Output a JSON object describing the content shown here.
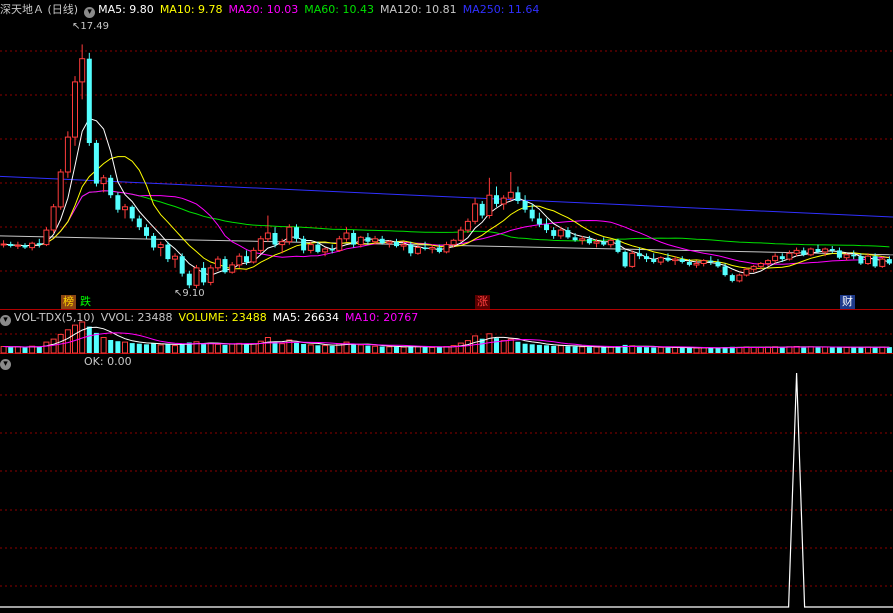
{
  "main": {
    "title": "深天地Ａ (日线)",
    "indicators": [
      {
        "text": "MA5: 9.80",
        "color": "#ffffff"
      },
      {
        "text": "MA10: 9.78",
        "color": "#ffff00"
      },
      {
        "text": "MA20: 10.03",
        "color": "#ff00ff"
      },
      {
        "text": "MA60: 10.43",
        "color": "#00e000"
      },
      {
        "text": "MA120: 10.81",
        "color": "#c8c8c8"
      },
      {
        "text": "MA250: 11.64",
        "color": "#3030ff"
      }
    ],
    "high_label": "17.49",
    "low_label": "9.10",
    "badges": [
      {
        "text": "榜",
        "color": "#ffd700",
        "bg": "#8b4513"
      },
      {
        "text": "跌",
        "color": "#00ff00",
        "bg": "#000000"
      },
      {
        "text": "涨",
        "color": "#ff4040",
        "bg": "#5a0000"
      },
      {
        "text": "财",
        "color": "#ffffff",
        "bg": "#1e3a8a"
      }
    ]
  },
  "volume": {
    "indicators": [
      {
        "text": "VOL-TDX(5,10)",
        "color": "#c8c8c8"
      },
      {
        "text": "VVOL: 23488",
        "color": "#c8c8c8"
      },
      {
        "text": "VOLUME: 23488",
        "color": "#ffff00"
      },
      {
        "text": "MA5: 26634",
        "color": "#ffffff"
      },
      {
        "text": "MA10: 20767",
        "color": "#ff00ff"
      }
    ]
  },
  "ok_panel": {
    "label": "OK: 0.00"
  },
  "colors": {
    "up": "#ff3c3c",
    "down": "#54ffff",
    "grid": "#8b0000",
    "ma5": "#ffffff",
    "ma10": "#ffff00",
    "ma20": "#ff00ff",
    "ma60": "#00e000",
    "ma120": "#c8c8c8",
    "ma250": "#3030ff"
  },
  "chart_data": {
    "type": "candlestick",
    "price_range": [
      8.9,
      18.4
    ],
    "candles": [
      [
        10.6,
        10.75,
        10.5,
        10.62
      ],
      [
        10.62,
        10.7,
        10.5,
        10.55
      ],
      [
        10.55,
        10.7,
        10.45,
        10.58
      ],
      [
        10.58,
        10.65,
        10.45,
        10.5
      ],
      [
        10.5,
        10.7,
        10.4,
        10.65
      ],
      [
        10.65,
        10.8,
        10.5,
        10.6
      ],
      [
        10.6,
        11.2,
        10.55,
        11.1
      ],
      [
        11.1,
        12.0,
        11.0,
        11.9
      ],
      [
        11.9,
        13.2,
        11.8,
        13.1
      ],
      [
        13.1,
        14.5,
        12.9,
        14.3
      ],
      [
        14.3,
        16.4,
        14.0,
        16.2
      ],
      [
        16.2,
        17.49,
        15.6,
        17.0
      ],
      [
        17.0,
        17.2,
        14.0,
        14.1
      ],
      [
        14.1,
        14.2,
        12.6,
        12.7
      ],
      [
        12.7,
        13.0,
        12.4,
        12.9
      ],
      [
        12.9,
        13.0,
        12.2,
        12.3
      ],
      [
        12.3,
        12.4,
        11.7,
        11.8
      ],
      [
        11.8,
        12.0,
        11.5,
        11.9
      ],
      [
        11.9,
        11.95,
        11.4,
        11.5
      ],
      [
        11.5,
        11.6,
        11.1,
        11.2
      ],
      [
        11.2,
        11.3,
        10.8,
        10.9
      ],
      [
        10.9,
        11.0,
        10.4,
        10.5
      ],
      [
        10.5,
        10.7,
        10.2,
        10.6
      ],
      [
        10.6,
        10.7,
        10.0,
        10.1
      ],
      [
        10.1,
        10.3,
        9.8,
        10.2
      ],
      [
        10.2,
        10.3,
        9.5,
        9.6
      ],
      [
        9.6,
        9.7,
        9.1,
        9.2
      ],
      [
        9.2,
        9.9,
        9.1,
        9.8
      ],
      [
        9.8,
        10.0,
        9.2,
        9.3
      ],
      [
        9.3,
        9.9,
        9.2,
        9.8
      ],
      [
        9.8,
        10.2,
        9.7,
        10.1
      ],
      [
        10.1,
        10.2,
        9.6,
        9.65
      ],
      [
        9.65,
        10.0,
        9.6,
        9.9
      ],
      [
        9.9,
        10.3,
        9.8,
        10.2
      ],
      [
        10.2,
        10.4,
        9.9,
        10.0
      ],
      [
        10.0,
        10.5,
        9.95,
        10.4
      ],
      [
        10.4,
        10.9,
        10.3,
        10.8
      ],
      [
        10.8,
        11.6,
        10.7,
        11.0
      ],
      [
        11.0,
        11.2,
        10.5,
        10.6
      ],
      [
        10.6,
        10.8,
        10.3,
        10.7
      ],
      [
        10.7,
        11.3,
        10.6,
        11.2
      ],
      [
        11.2,
        11.3,
        10.7,
        10.8
      ],
      [
        10.8,
        10.9,
        10.3,
        10.4
      ],
      [
        10.4,
        10.7,
        10.3,
        10.6
      ],
      [
        10.6,
        10.7,
        10.3,
        10.35
      ],
      [
        10.35,
        10.5,
        10.2,
        10.45
      ],
      [
        10.45,
        10.6,
        10.3,
        10.4
      ],
      [
        10.4,
        10.9,
        10.35,
        10.8
      ],
      [
        10.8,
        11.2,
        10.7,
        11.0
      ],
      [
        11.0,
        11.1,
        10.5,
        10.6
      ],
      [
        10.6,
        10.9,
        10.5,
        10.85
      ],
      [
        10.85,
        11.0,
        10.6,
        10.7
      ],
      [
        10.7,
        10.9,
        10.6,
        10.8
      ],
      [
        10.8,
        10.9,
        10.6,
        10.65
      ],
      [
        10.65,
        10.75,
        10.5,
        10.7
      ],
      [
        10.7,
        10.8,
        10.5,
        10.55
      ],
      [
        10.55,
        10.7,
        10.4,
        10.6
      ],
      [
        10.6,
        10.7,
        10.2,
        10.3
      ],
      [
        10.3,
        10.6,
        10.25,
        10.5
      ],
      [
        10.5,
        10.7,
        10.4,
        10.45
      ],
      [
        10.45,
        10.6,
        10.3,
        10.5
      ],
      [
        10.5,
        10.6,
        10.3,
        10.35
      ],
      [
        10.35,
        10.7,
        10.3,
        10.6
      ],
      [
        10.6,
        10.8,
        10.5,
        10.75
      ],
      [
        10.75,
        11.2,
        10.7,
        11.1
      ],
      [
        11.1,
        11.5,
        11.0,
        11.4
      ],
      [
        11.4,
        12.2,
        11.3,
        12.0
      ],
      [
        12.0,
        12.1,
        11.5,
        11.6
      ],
      [
        11.6,
        12.9,
        11.5,
        12.3
      ],
      [
        12.3,
        12.6,
        11.9,
        12.0
      ],
      [
        12.0,
        12.3,
        11.8,
        12.2
      ],
      [
        12.2,
        13.1,
        12.1,
        12.4
      ],
      [
        12.4,
        12.6,
        12.0,
        12.1
      ],
      [
        12.1,
        12.3,
        11.7,
        11.8
      ],
      [
        11.8,
        12.0,
        11.4,
        11.5
      ],
      [
        11.5,
        11.7,
        11.2,
        11.3
      ],
      [
        11.3,
        11.5,
        11.0,
        11.1
      ],
      [
        11.1,
        11.2,
        10.8,
        10.9
      ],
      [
        10.9,
        11.2,
        10.8,
        11.1
      ],
      [
        11.1,
        11.2,
        10.8,
        10.85
      ],
      [
        10.85,
        11.0,
        10.7,
        10.75
      ],
      [
        10.75,
        10.9,
        10.6,
        10.8
      ],
      [
        10.8,
        10.9,
        10.6,
        10.65
      ],
      [
        10.65,
        10.8,
        10.5,
        10.7
      ],
      [
        10.7,
        10.85,
        10.55,
        10.6
      ],
      [
        10.6,
        10.8,
        10.5,
        10.75
      ],
      [
        10.75,
        10.8,
        10.3,
        10.35
      ],
      [
        10.35,
        10.4,
        9.8,
        9.85
      ],
      [
        9.85,
        10.4,
        9.8,
        10.3
      ],
      [
        10.3,
        10.5,
        10.1,
        10.2
      ],
      [
        10.2,
        10.3,
        10.0,
        10.1
      ],
      [
        10.1,
        10.3,
        9.95,
        10.0
      ],
      [
        10.0,
        10.2,
        9.9,
        10.15
      ],
      [
        10.15,
        10.3,
        10.0,
        10.05
      ],
      [
        10.05,
        10.2,
        9.9,
        10.1
      ],
      [
        10.1,
        10.2,
        9.95,
        10.0
      ],
      [
        10.0,
        10.1,
        9.85,
        9.9
      ],
      [
        9.9,
        10.05,
        9.8,
        9.95
      ],
      [
        9.95,
        10.1,
        9.85,
        10.05
      ],
      [
        10.05,
        10.2,
        9.9,
        10.0
      ],
      [
        10.0,
        10.1,
        9.8,
        9.85
      ],
      [
        9.85,
        9.95,
        9.5,
        9.55
      ],
      [
        9.55,
        9.6,
        9.3,
        9.35
      ],
      [
        9.35,
        9.6,
        9.3,
        9.55
      ],
      [
        9.55,
        9.8,
        9.5,
        9.75
      ],
      [
        9.75,
        9.9,
        9.65,
        9.85
      ],
      [
        9.85,
        10.0,
        9.75,
        9.95
      ],
      [
        9.95,
        10.1,
        9.85,
        10.05
      ],
      [
        10.05,
        10.3,
        9.95,
        10.2
      ],
      [
        10.2,
        10.3,
        10.0,
        10.1
      ],
      [
        10.1,
        10.4,
        10.05,
        10.3
      ],
      [
        10.3,
        10.5,
        10.2,
        10.4
      ],
      [
        10.4,
        10.5,
        10.2,
        10.25
      ],
      [
        10.25,
        10.5,
        10.2,
        10.45
      ],
      [
        10.45,
        10.6,
        10.3,
        10.35
      ],
      [
        10.35,
        10.5,
        10.2,
        10.45
      ],
      [
        10.45,
        10.55,
        10.3,
        10.4
      ],
      [
        10.4,
        10.5,
        10.1,
        10.15
      ],
      [
        10.15,
        10.3,
        10.05,
        10.25
      ],
      [
        10.25,
        10.4,
        10.1,
        10.2
      ],
      [
        10.2,
        10.3,
        9.9,
        9.95
      ],
      [
        9.95,
        10.3,
        9.9,
        10.2
      ],
      [
        10.2,
        10.3,
        9.8,
        9.85
      ],
      [
        9.85,
        10.2,
        9.8,
        10.1
      ],
      [
        10.1,
        10.2,
        9.9,
        9.95
      ]
    ],
    "volume": [
      2.1,
      1.9,
      2.0,
      1.8,
      2.2,
      2.0,
      3.5,
      4.5,
      6.0,
      7.5,
      9.0,
      10.0,
      8.5,
      6.5,
      5.0,
      4.2,
      3.8,
      3.5,
      3.2,
      3.0,
      2.8,
      3.2,
      2.6,
      2.8,
      2.4,
      3.0,
      3.4,
      3.6,
      3.0,
      3.2,
      2.8,
      2.6,
      2.9,
      3.1,
      2.7,
      3.0,
      3.8,
      5.0,
      3.6,
      3.0,
      4.2,
      3.3,
      2.9,
      2.6,
      2.5,
      2.4,
      2.3,
      3.0,
      3.5,
      2.8,
      2.6,
      2.4,
      2.2,
      2.1,
      2.0,
      2.0,
      1.9,
      2.2,
      2.0,
      1.9,
      1.8,
      1.9,
      2.1,
      2.4,
      3.2,
      4.0,
      5.5,
      4.6,
      6.2,
      4.8,
      4.0,
      4.5,
      3.6,
      3.0,
      2.8,
      2.6,
      2.5,
      2.3,
      2.4,
      2.2,
      2.1,
      2.0,
      1.9,
      1.9,
      1.8,
      1.9,
      2.2,
      2.6,
      2.3,
      2.0,
      1.9,
      1.8,
      1.8,
      1.7,
      1.8,
      1.7,
      1.7,
      1.6,
      1.7,
      1.7,
      1.6,
      1.9,
      2.0,
      1.8,
      1.9,
      1.8,
      1.8,
      1.9,
      2.0,
      1.9,
      2.0,
      2.1,
      1.9,
      2.0,
      1.9,
      1.9,
      1.9,
      1.8,
      1.8,
      1.8,
      1.9,
      1.9,
      1.8,
      1.9,
      1.9
    ],
    "ma_lines": {
      "ma120": [
        10.9,
        10.25
      ],
      "ma250": [
        12.95,
        11.55
      ]
    },
    "ok_signal_index": 111
  }
}
